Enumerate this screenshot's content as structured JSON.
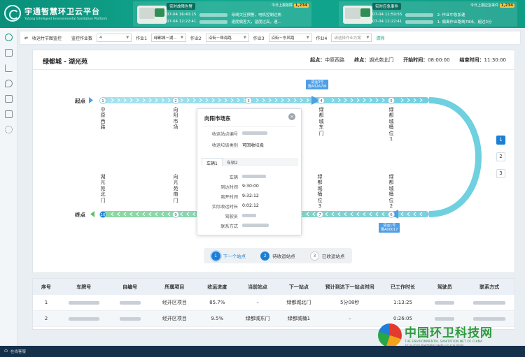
{
  "app": {
    "title": "宇通智慧环卫云平台",
    "subtitle": "Yutong Intelligent Environmental Sanitation Platform"
  },
  "alerts": [
    {
      "badge": "实时故障告警",
      "count_prefix": "今日上报故障",
      "count": "1,234",
      "rows": [
        {
          "time": "07-04 16:40:15",
          "text": "母线欠压预警，电机控制过热"
        },
        {
          "time": "07-04 12:22:41",
          "text": "速度偏差大，温度过高，速..."
        }
      ]
    },
    {
      "badge": "实时应急事件",
      "count_prefix": "今日上报应急事件",
      "count": "1,234",
      "rows": [
        {
          "time": "07-04 11:59:55",
          "text": "2: 作业中急加速"
        },
        {
          "time": "07-04 12:22:41",
          "text": "1: 偏离作业路线78米，超过3分"
        }
      ]
    }
  ],
  "filters": {
    "page_label": "收运竹节图监控",
    "monitor_label": "监控作业数",
    "monitor_value": "4",
    "jobs": [
      {
        "label": "作业1",
        "value": "绿都城－湖..."
      },
      {
        "label": "作业2",
        "value": "沿街－珠海路"
      },
      {
        "label": "作业3",
        "value": "沿街－东风路"
      },
      {
        "label": "作业4",
        "placeholder": "请选择作业方案"
      }
    ],
    "clear_label": "清除"
  },
  "route": {
    "title": "绿都城 - 湖光苑",
    "start_label": "起点：",
    "start_value": "中原西路",
    "end_label": "终点：",
    "end_value": "湖光苑北门",
    "start_time_label": "开始时间：",
    "start_time_value": "08:00:00",
    "end_time_label": "结束时间：",
    "end_time_value": "11:30:00",
    "origin_label": "起点",
    "terminal_label": "终点",
    "top_stations": [
      {
        "num": "1",
        "name": "中原西路"
      },
      {
        "num": "2",
        "name": "向阳市场"
      },
      {
        "num": "3",
        "name": ""
      },
      {
        "num": "4",
        "name": "绿都城东门"
      },
      {
        "num": "5",
        "name": "绿都城桶位1"
      }
    ],
    "bottom_stations": [
      {
        "num": "10",
        "name": "湖光苑北门"
      },
      {
        "num": "9",
        "name": "向光苑南门"
      },
      {
        "num": "7",
        "name": "绿都城桶位3"
      },
      {
        "num": "6",
        "name": "绿都城桶位2"
      }
    ],
    "vehicles": [
      {
        "line1": "清运3号",
        "line2": "豫A32A7W"
      },
      {
        "line1": "清运1号",
        "line2": "豫A00017"
      }
    ],
    "pages": [
      "1",
      "2",
      "3"
    ]
  },
  "popup": {
    "title": "向阳市场东",
    "fields": [
      {
        "label": "收运站点编号"
      },
      {
        "label": "收运垃圾类别",
        "value": "可回收垃圾"
      }
    ],
    "tabs": [
      "车辆1",
      "车辆2"
    ],
    "vehicle_fields": [
      {
        "label": "车辆"
      },
      {
        "label": "到达时间",
        "value": "9:30:00"
      },
      {
        "label": "离开时间",
        "value": "9:32:12"
      },
      {
        "label": "实际收运时长",
        "value": "0:02:12"
      },
      {
        "label": "驾驶员"
      },
      {
        "label": "联系方式"
      }
    ]
  },
  "legend": [
    {
      "num": "1",
      "label": "下一个站点"
    },
    {
      "num": "2",
      "label": "待收运站点"
    },
    {
      "num": "3",
      "label": "已收运站点"
    }
  ],
  "table": {
    "headers": [
      "序号",
      "车牌号",
      "自编号",
      "所属项目",
      "收运进度",
      "当前站点",
      "下一站点",
      "预计到达下一站点时间",
      "已工作时长",
      "驾驶员",
      "联系方式"
    ],
    "rows": [
      [
        "1",
        "",
        "",
        "经开区项目",
        "85.7%",
        "–",
        "绿都城北门",
        "5分08秒",
        "1:13:25",
        "",
        ""
      ],
      [
        "2",
        "",
        "",
        "经开区项目",
        "9.5%",
        "绿都城东门",
        "绿都城桶1",
        "–",
        "0:26:05",
        "",
        ""
      ]
    ]
  },
  "footer": {
    "label": "在线客服"
  },
  "watermark": {
    "title": "中国环卫科技网",
    "subtitle": "THE ENVIRONMENTAL SANITATION NET OF CHINA",
    "copyright": "2014-2018 郑州宇通环卫有限公司 ©环卫科技"
  },
  "colors": {
    "accent": "#1c9e86",
    "track": "#7fd4e8",
    "blue": "#1a7fd6"
  }
}
